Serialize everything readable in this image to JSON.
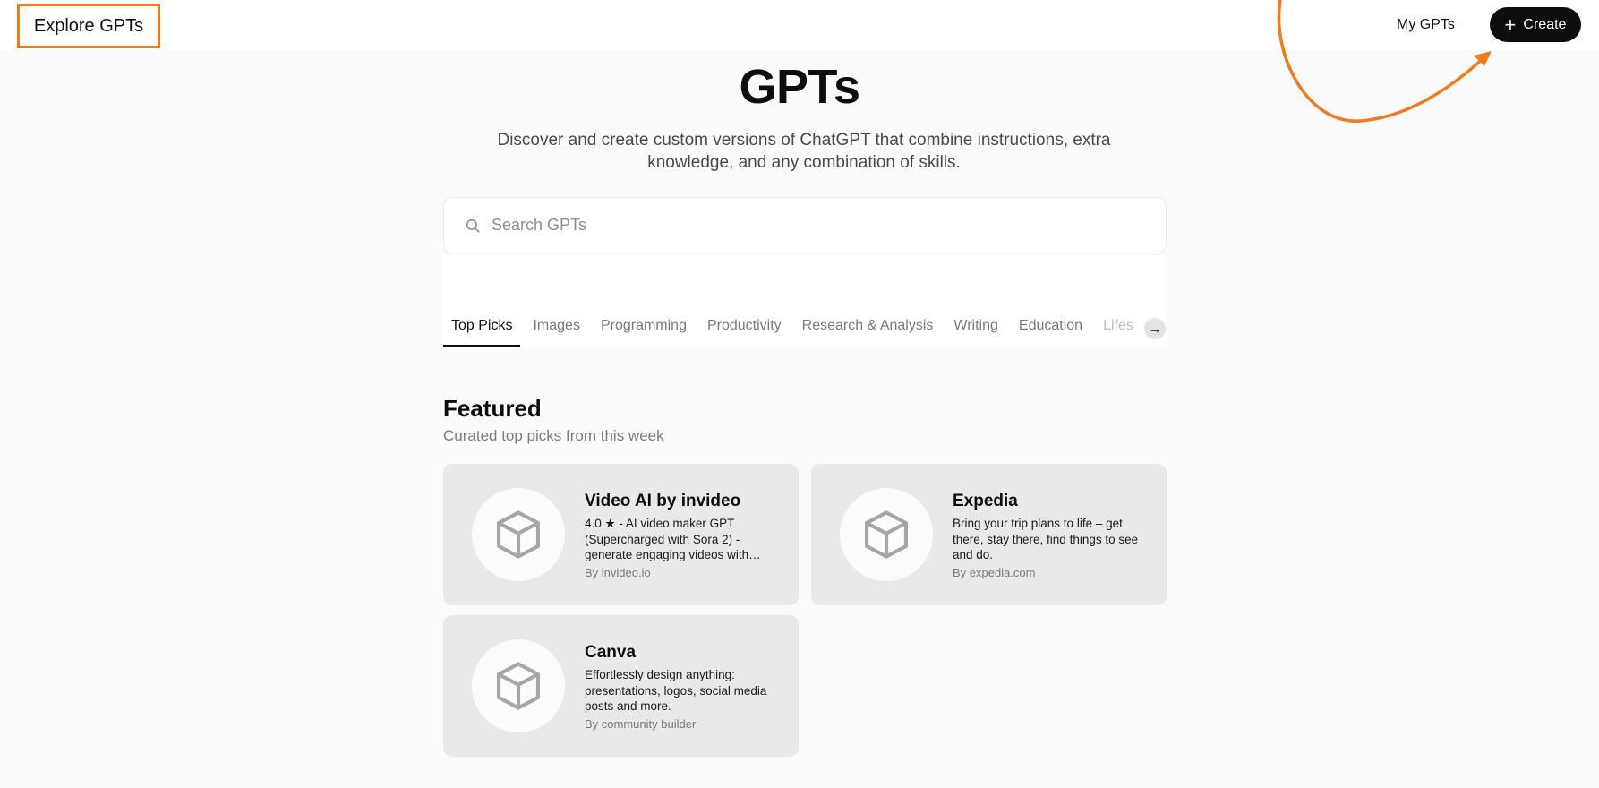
{
  "header": {
    "brand": "Explore GPTs",
    "my_gpts": "My GPTs",
    "create_label": "Create",
    "accent_color": "#f07a1e"
  },
  "hero": {
    "title": "GPTs",
    "subtitle": "Discover and create custom versions of ChatGPT that combine instructions, extra knowledge, and any combination of skills."
  },
  "search": {
    "placeholder": "Search GPTs",
    "icon": "search-icon"
  },
  "tabs": [
    {
      "label": "Top Picks",
      "active": true
    },
    {
      "label": "Images"
    },
    {
      "label": "Programming"
    },
    {
      "label": "Productivity"
    },
    {
      "label": "Research & Analysis"
    },
    {
      "label": "Writing"
    },
    {
      "label": "Education"
    },
    {
      "label": "Lifes"
    }
  ],
  "tabs_next_icon": "arrow-right-icon",
  "featured": {
    "title": "Featured",
    "subtitle": "Curated top picks from this week",
    "cards": [
      {
        "title": "Video AI by invideo",
        "description": "4.0 ★ - AI video maker GPT (Supercharged with Sora 2) - generate engaging videos with…",
        "by": "By invideo.io",
        "icon": "cube-icon"
      },
      {
        "title": "Expedia",
        "description": "Bring your trip plans to life – get there, stay there, find things to see and do.",
        "by": "By expedia.com",
        "icon": "cube-icon"
      },
      {
        "title": "Canva",
        "description": "Effortlessly design anything: presentations, logos, social media posts and more.",
        "by": "By community builder",
        "icon": "cube-icon"
      }
    ]
  }
}
